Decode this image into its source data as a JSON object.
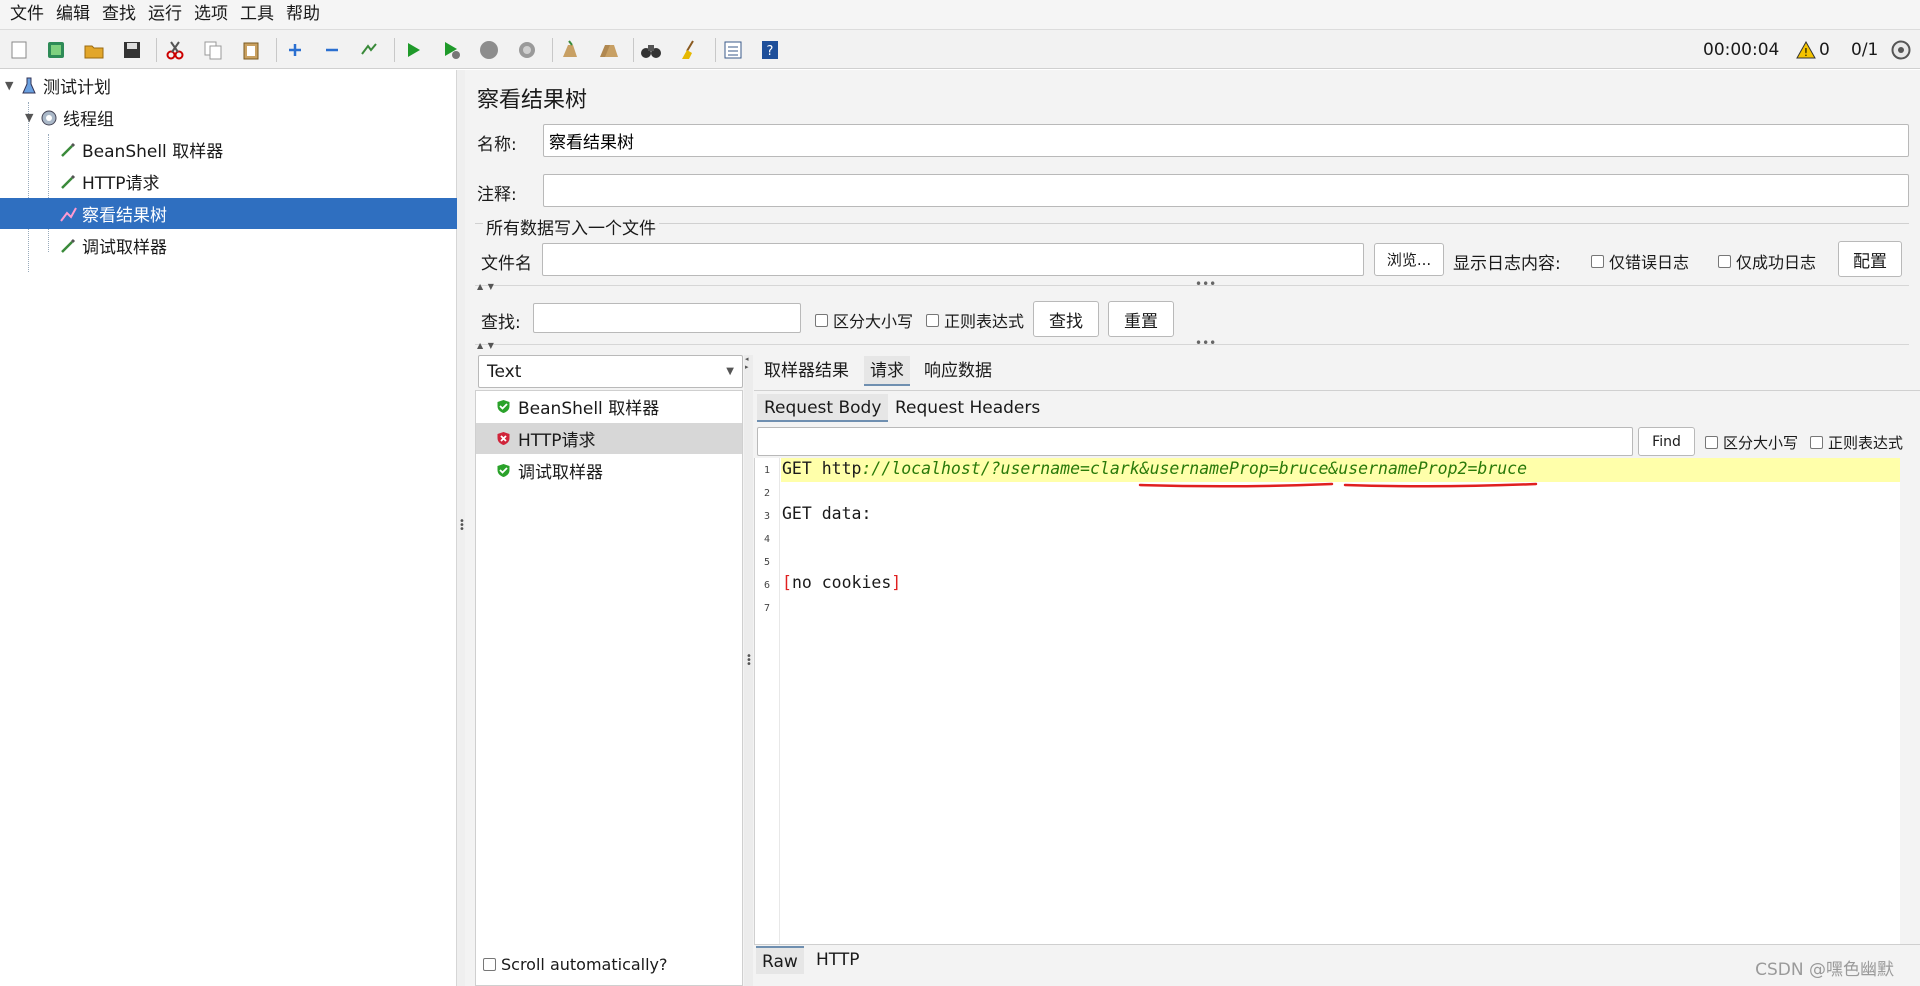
{
  "menu": [
    "文件",
    "编辑",
    "查找",
    "运行",
    "选项",
    "工具",
    "帮助"
  ],
  "toolbar": {
    "timer": "00:00:04",
    "warning_count": "0",
    "threads": "0/1"
  },
  "tree": {
    "items": [
      {
        "label": "测试计划",
        "icon": "flask-icon"
      },
      {
        "label": "线程组",
        "icon": "gear-icon"
      },
      {
        "label": "BeanShell 取样器",
        "icon": "pipette-icon"
      },
      {
        "label": "HTTP请求",
        "icon": "pipette-icon"
      },
      {
        "label": "察看结果树",
        "icon": "graph-icon"
      },
      {
        "label": "调试取样器",
        "icon": "pipette-icon"
      }
    ]
  },
  "panel": {
    "title": "察看结果树",
    "name_label": "名称:",
    "name_value": "察看结果树",
    "comment_label": "注释:",
    "comment_value": "",
    "file_section_title": "所有数据写入一个文件",
    "filename_label": "文件名",
    "filename_value": "",
    "browse_button": "浏览...",
    "log_display_label": "显示日志内容:",
    "errors_only_label": "仅错误日志",
    "success_only_label": "仅成功日志",
    "configure_button": "配置"
  },
  "search": {
    "label": "查找:",
    "value": "",
    "case_label": "区分大小写",
    "regex_label": "正则表达式",
    "find_button": "查找",
    "reset_button": "重置"
  },
  "renderer": {
    "selected": "Text"
  },
  "results": [
    {
      "label": "BeanShell 取样器",
      "status": "success"
    },
    {
      "label": "HTTP请求",
      "status": "error"
    },
    {
      "label": "调试取样器",
      "status": "success"
    }
  ],
  "scroll_auto_label": "Scroll automatically?",
  "detail_tabs": [
    "取样器结果",
    "请求",
    "响应数据"
  ],
  "sub_tabs": [
    "Request Body",
    "Request Headers"
  ],
  "editor_find": {
    "value": "",
    "find_button": "Find",
    "case_label": "区分大小写",
    "regex_label": "正则表达式"
  },
  "editor": {
    "lines": [
      {
        "n": "1",
        "prefix": "GET http",
        "url": "://localhost/?username=clark&usernameProp=bruce&usernameProp2=bruce"
      },
      {
        "n": "2",
        "text": ""
      },
      {
        "n": "3",
        "text": "GET data:"
      },
      {
        "n": "4",
        "text": ""
      },
      {
        "n": "5",
        "text": ""
      },
      {
        "n": "6",
        "open": "[",
        "text": "no cookies",
        "close": "]"
      },
      {
        "n": "7",
        "text": ""
      }
    ]
  },
  "bottom_tabs": [
    "Raw",
    "HTTP"
  ],
  "watermark": "CSDN @嘿色幽默",
  "colors": {
    "selection": "#2f6fc0",
    "highlight_line": "#ffffaa",
    "annotation_underline": "#e02020"
  }
}
